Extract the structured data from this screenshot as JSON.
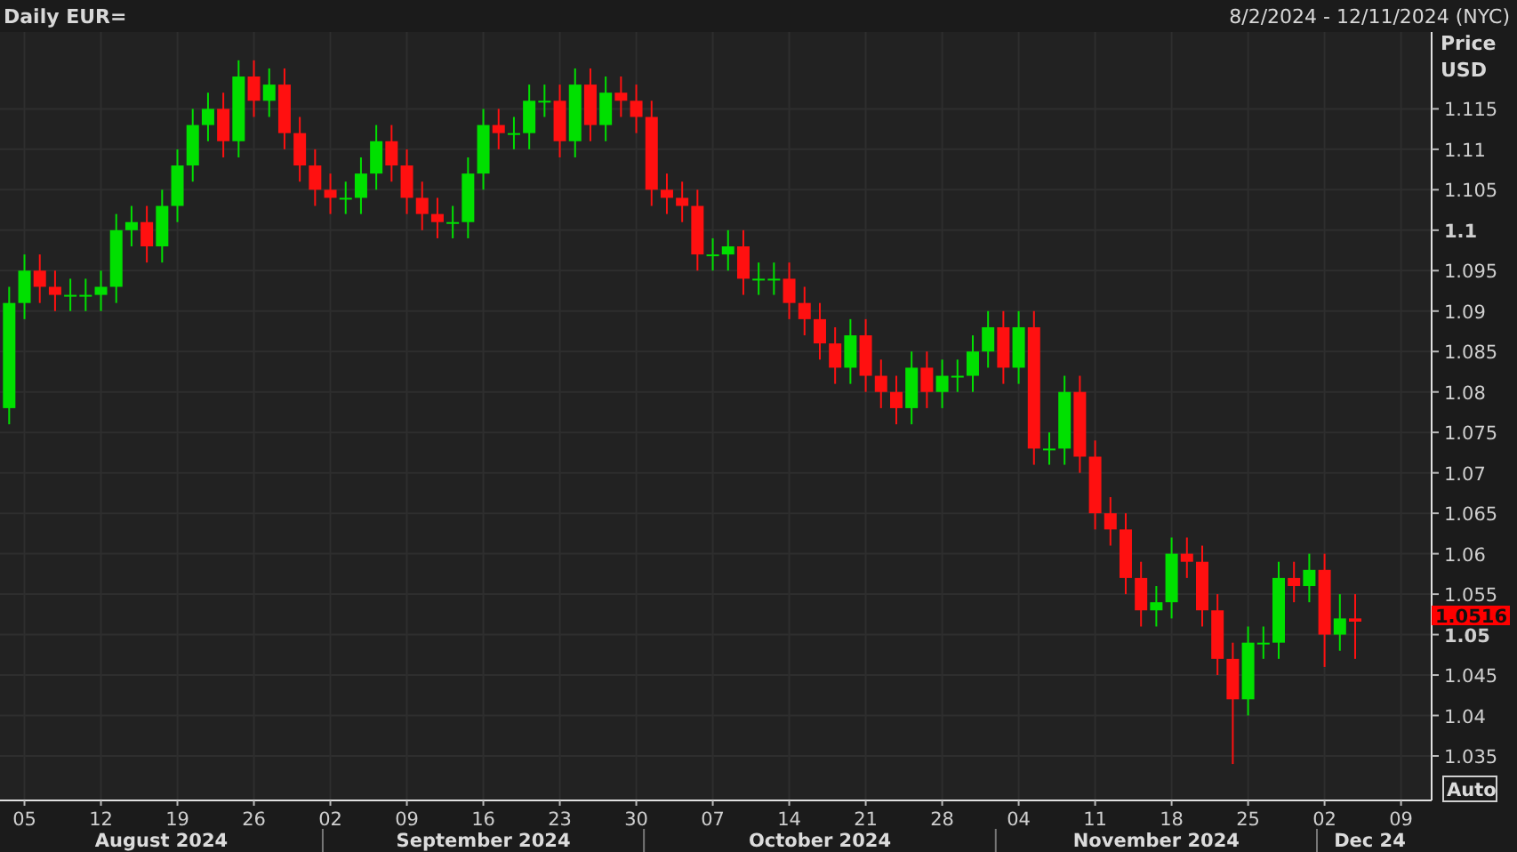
{
  "header": {
    "title": "Daily EUR=",
    "date_range": "8/2/2024 - 12/11/2024 (NYC)"
  },
  "chart_data": {
    "type": "candlestick",
    "ylabel": "Price\nUSD",
    "ylim": [
      1.0295,
      1.1245
    ],
    "grid": true,
    "yticks": [
      1.035,
      1.04,
      1.045,
      {
        "value": 1.05,
        "label": "1.05"
      },
      1.055,
      1.06,
      1.065,
      1.07,
      1.075,
      1.08,
      1.085,
      1.09,
      1.095,
      {
        "value": 1.1,
        "label": "1.1"
      },
      1.105,
      1.11,
      1.115
    ],
    "categories": [
      null,
      "05",
      null,
      null,
      null,
      null,
      "12",
      null,
      null,
      null,
      null,
      "19",
      null,
      null,
      null,
      null,
      "26",
      null,
      null,
      null,
      null,
      "02",
      null,
      null,
      null,
      null,
      "09",
      null,
      null,
      null,
      null,
      "16",
      null,
      null,
      null,
      null,
      "23",
      null,
      null,
      null,
      null,
      "30",
      null,
      null,
      null,
      null,
      "07",
      null,
      null,
      null,
      null,
      "14",
      null,
      null,
      null,
      null,
      "21",
      null,
      null,
      null,
      null,
      "28",
      null,
      null,
      null,
      null,
      "04",
      null,
      null,
      null,
      null,
      "11",
      null,
      null,
      null,
      null,
      "18",
      null,
      null,
      null,
      null,
      "25",
      null,
      null,
      null,
      null,
      "02",
      null,
      null,
      null,
      null,
      "09"
    ],
    "ohlc": [
      [
        1.078,
        1.093,
        1.076,
        1.091
      ],
      [
        1.091,
        1.097,
        1.089,
        1.095
      ],
      [
        1.095,
        1.097,
        1.091,
        1.093
      ],
      [
        1.093,
        1.095,
        1.09,
        1.092
      ],
      [
        1.092,
        1.094,
        1.09,
        1.092
      ],
      [
        1.092,
        1.094,
        1.09,
        1.092
      ],
      [
        1.092,
        1.095,
        1.09,
        1.093
      ],
      [
        1.093,
        1.102,
        1.091,
        1.1
      ],
      [
        1.1,
        1.103,
        1.098,
        1.101
      ],
      [
        1.101,
        1.103,
        1.096,
        1.098
      ],
      [
        1.098,
        1.105,
        1.096,
        1.103
      ],
      [
        1.103,
        1.11,
        1.101,
        1.108
      ],
      [
        1.108,
        1.115,
        1.106,
        1.113
      ],
      [
        1.113,
        1.117,
        1.111,
        1.115
      ],
      [
        1.115,
        1.117,
        1.109,
        1.111
      ],
      [
        1.111,
        1.121,
        1.109,
        1.119
      ],
      [
        1.119,
        1.121,
        1.114,
        1.116
      ],
      [
        1.116,
        1.12,
        1.114,
        1.118
      ],
      [
        1.118,
        1.12,
        1.11,
        1.112
      ],
      [
        1.112,
        1.114,
        1.106,
        1.108
      ],
      [
        1.108,
        1.11,
        1.103,
        1.105
      ],
      [
        1.105,
        1.107,
        1.102,
        1.104
      ],
      [
        1.104,
        1.106,
        1.102,
        1.104
      ],
      [
        1.104,
        1.109,
        1.102,
        1.107
      ],
      [
        1.107,
        1.113,
        1.105,
        1.111
      ],
      [
        1.111,
        1.113,
        1.106,
        1.108
      ],
      [
        1.108,
        1.11,
        1.102,
        1.104
      ],
      [
        1.104,
        1.106,
        1.1,
        1.102
      ],
      [
        1.102,
        1.104,
        1.099,
        1.101
      ],
      [
        1.101,
        1.103,
        1.099,
        1.101
      ],
      [
        1.101,
        1.109,
        1.099,
        1.107
      ],
      [
        1.107,
        1.115,
        1.105,
        1.113
      ],
      [
        1.113,
        1.115,
        1.11,
        1.112
      ],
      [
        1.112,
        1.114,
        1.11,
        1.112
      ],
      [
        1.112,
        1.118,
        1.11,
        1.116
      ],
      [
        1.116,
        1.118,
        1.114,
        1.116
      ],
      [
        1.116,
        1.118,
        1.109,
        1.111
      ],
      [
        1.111,
        1.12,
        1.109,
        1.118
      ],
      [
        1.118,
        1.12,
        1.111,
        1.113
      ],
      [
        1.113,
        1.119,
        1.111,
        1.117
      ],
      [
        1.117,
        1.119,
        1.114,
        1.116
      ],
      [
        1.116,
        1.118,
        1.112,
        1.114
      ],
      [
        1.114,
        1.116,
        1.103,
        1.105
      ],
      [
        1.105,
        1.107,
        1.102,
        1.104
      ],
      [
        1.104,
        1.106,
        1.101,
        1.103
      ],
      [
        1.103,
        1.105,
        1.095,
        1.097
      ],
      [
        1.097,
        1.099,
        1.095,
        1.097
      ],
      [
        1.097,
        1.1,
        1.095,
        1.098
      ],
      [
        1.098,
        1.1,
        1.092,
        1.094
      ],
      [
        1.094,
        1.096,
        1.092,
        1.094
      ],
      [
        1.094,
        1.096,
        1.092,
        1.094
      ],
      [
        1.094,
        1.096,
        1.089,
        1.091
      ],
      [
        1.091,
        1.093,
        1.087,
        1.089
      ],
      [
        1.089,
        1.091,
        1.084,
        1.086
      ],
      [
        1.086,
        1.088,
        1.081,
        1.083
      ],
      [
        1.083,
        1.089,
        1.081,
        1.087
      ],
      [
        1.087,
        1.089,
        1.08,
        1.082
      ],
      [
        1.082,
        1.084,
        1.078,
        1.08
      ],
      [
        1.08,
        1.082,
        1.076,
        1.078
      ],
      [
        1.078,
        1.085,
        1.076,
        1.083
      ],
      [
        1.083,
        1.085,
        1.078,
        1.08
      ],
      [
        1.08,
        1.084,
        1.078,
        1.082
      ],
      [
        1.082,
        1.084,
        1.08,
        1.082
      ],
      [
        1.082,
        1.087,
        1.08,
        1.085
      ],
      [
        1.085,
        1.09,
        1.083,
        1.088
      ],
      [
        1.088,
        1.09,
        1.081,
        1.083
      ],
      [
        1.083,
        1.09,
        1.081,
        1.088
      ],
      [
        1.088,
        1.09,
        1.071,
        1.073
      ],
      [
        1.073,
        1.075,
        1.071,
        1.073
      ],
      [
        1.073,
        1.082,
        1.071,
        1.08
      ],
      [
        1.08,
        1.082,
        1.07,
        1.072
      ],
      [
        1.072,
        1.074,
        1.063,
        1.065
      ],
      [
        1.065,
        1.067,
        1.061,
        1.063
      ],
      [
        1.063,
        1.065,
        1.055,
        1.057
      ],
      [
        1.057,
        1.059,
        1.051,
        1.053
      ],
      [
        1.053,
        1.056,
        1.051,
        1.054
      ],
      [
        1.054,
        1.062,
        1.052,
        1.06
      ],
      [
        1.06,
        1.062,
        1.057,
        1.059
      ],
      [
        1.059,
        1.061,
        1.051,
        1.053
      ],
      [
        1.053,
        1.055,
        1.045,
        1.047
      ],
      [
        1.047,
        1.049,
        1.034,
        1.042
      ],
      [
        1.042,
        1.051,
        1.04,
        1.049
      ],
      [
        1.049,
        1.051,
        1.047,
        1.049
      ],
      [
        1.049,
        1.059,
        1.047,
        1.057
      ],
      [
        1.057,
        1.059,
        1.054,
        1.056
      ],
      [
        1.056,
        1.06,
        1.054,
        1.058
      ],
      [
        1.058,
        1.06,
        1.046,
        1.05
      ],
      [
        1.05,
        1.055,
        1.048,
        1.052
      ],
      [
        1.052,
        1.055,
        1.047,
        1.0516
      ],
      null,
      null,
      null
    ]
  },
  "months": [
    {
      "label": "August 2024"
    },
    {
      "label": "September 2024"
    },
    {
      "label": "October 2024"
    },
    {
      "label": "November 2024"
    },
    {
      "label": "Dec 24"
    }
  ],
  "last_price": "1.0516",
  "scale_button": "Auto"
}
